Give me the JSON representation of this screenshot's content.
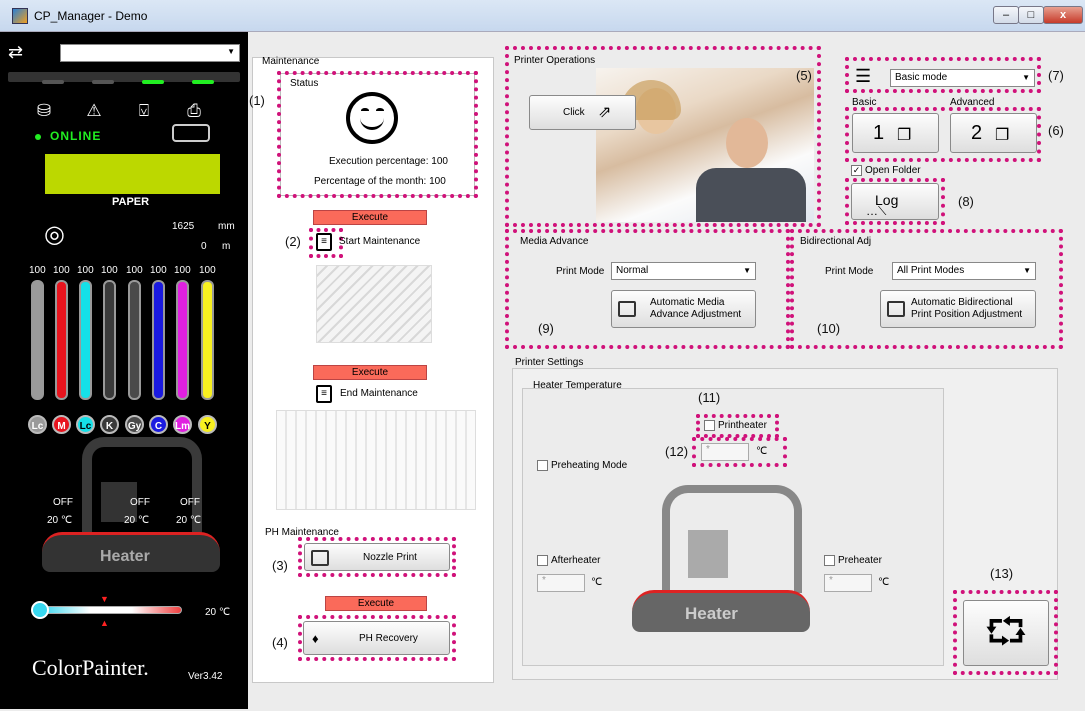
{
  "window": {
    "title": "CP_Manager - Demo",
    "minimize": "–",
    "maximize": "□",
    "close": "x"
  },
  "left": {
    "printer_combo": "",
    "online": "ONLINE",
    "media": "PAPER",
    "length_mm": "1625",
    "length_unit_mm": "mm",
    "remaining_m": "0",
    "remaining_unit": "m",
    "ink_levels": [
      "100",
      "100",
      "100",
      "100",
      "100",
      "100",
      "100",
      "100"
    ],
    "inks": [
      "Lc",
      "M",
      "Lc",
      "K",
      "Gy",
      "C",
      "Lm",
      "Y"
    ],
    "ink_colors": [
      "#9a9a9a",
      "#e8141e",
      "#15e0e8",
      "#3a3a3a",
      "#4a4a4a",
      "#1a1ae0",
      "#e020e0",
      "#f8f020"
    ],
    "heater": {
      "off1": "OFF",
      "off2": "OFF",
      "off3": "OFF",
      "t1": "20 ℃",
      "t2": "20 ℃",
      "t3": "20 ℃",
      "label": "Heater"
    },
    "slider_temp": "20 ℃",
    "logo": "ColorPainter.",
    "version": "Ver3.42"
  },
  "maintenance": {
    "title": "Maintenance",
    "status_title": "Status",
    "exec_pct": "Execution percentage: 100",
    "month_pct": "Percentage of the month: 100",
    "execute1": "Execute",
    "start": "Start Maintenance",
    "execute2": "Execute",
    "end": "End Maintenance",
    "ph_title": "PH Maintenance",
    "nozzle": "Nozzle Print",
    "execute3": "Execute",
    "recovery": "PH Recovery"
  },
  "operations": {
    "title": "Printer Operations",
    "click": "Click",
    "mode": "Basic mode",
    "basic": "Basic",
    "advanced": "Advanced",
    "b1": "1",
    "b2": "2",
    "open_folder": "Open Folder",
    "log": "Log"
  },
  "media": {
    "title": "Media Advance",
    "print_mode_label": "Print Mode",
    "print_mode": "Normal",
    "btn1": "Automatic Media",
    "btn2": "Advance Adjustment"
  },
  "bidir": {
    "title": "Bidirectional Adj",
    "print_mode_label": "Print Mode",
    "print_mode": "All Print Modes",
    "btn1": "Automatic Bidirectional",
    "btn2": "Print Position Adjustment"
  },
  "settings": {
    "title": "Printer Settings",
    "heater_title": "Heater Temperature",
    "printheater": "Printheater",
    "preheating": "Preheating Mode",
    "afterheater": "Afterheater",
    "preheater": "Preheater",
    "spin_value": "*",
    "unit": "℃",
    "heater_label": "Heater"
  },
  "annotations": [
    "(1)",
    "(2)",
    "(3)",
    "(4)",
    "(5)",
    "(6)",
    "(7)",
    "(8)",
    "(9)",
    "(10)",
    "(11)",
    "(12)",
    "(13)"
  ]
}
